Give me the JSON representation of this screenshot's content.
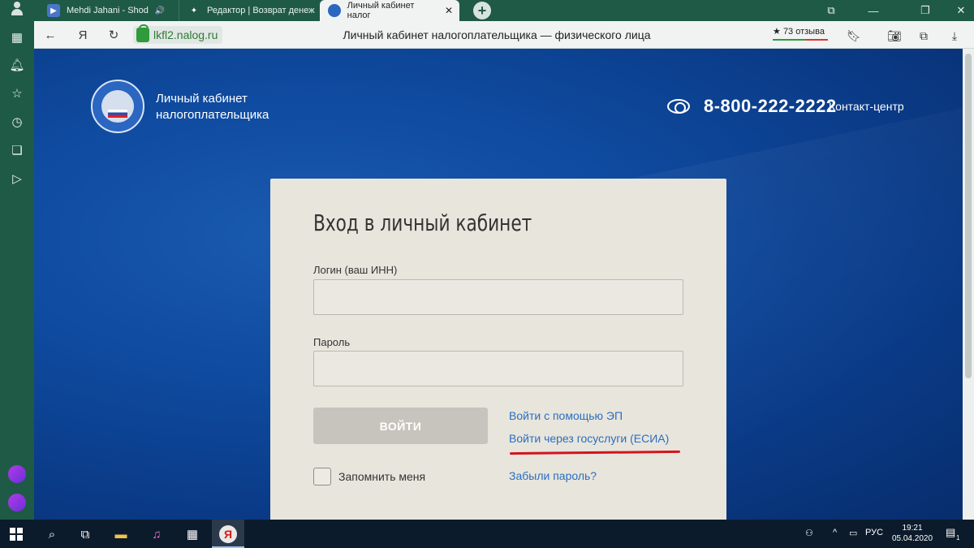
{
  "browser": {
    "tabs": [
      {
        "label": "Mehdi Jahani - Shod"
      },
      {
        "label": "Редактор | Возврат денеж"
      },
      {
        "label": "Личный кабинет налог"
      }
    ],
    "url": "lkfl2.nalog.ru",
    "page_title": "Личный кабинет налогоплательщика — физического лица",
    "reviews": "73 отзыва",
    "yandex_letter": "Я"
  },
  "header": {
    "logo_text_line1": "Личный кабинет",
    "logo_text_line2": "налогоплательщика",
    "phone": "8-800-222-2222",
    "contact": "Контакт-центр"
  },
  "login": {
    "title": "Вход в личный кабинет",
    "login_label": "Логин (ваш ИНН)",
    "password_label": "Пароль",
    "login_button": "ВОЙТИ",
    "ep_link": "Войти с помощью ЭП",
    "esia_link": "Войти через госуслуги (ЕСИА)",
    "remember": "Запомнить меня",
    "forgot": "Забыли пароль?"
  },
  "taskbar": {
    "lang": "РУС",
    "time": "19:21",
    "date": "05.04.2020",
    "notifications": "1"
  },
  "colors": {
    "browser_green": "#1f5a47",
    "page_blue": "#0f4ba0",
    "link_blue": "#2a6ec1",
    "highlight_red": "#d3141f"
  }
}
